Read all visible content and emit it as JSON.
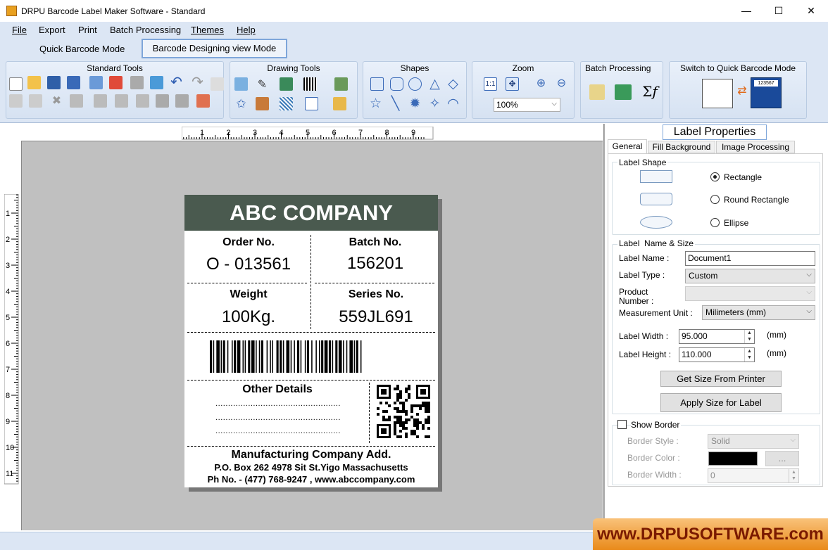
{
  "window": {
    "title": "DRPU Barcode Label Maker Software - Standard",
    "minimize": "—",
    "maximize": "☐",
    "close": "✕"
  },
  "menu": [
    "File",
    "Export",
    "Print",
    "Batch Processing",
    "Themes",
    "Help"
  ],
  "modes": {
    "quick": "Quick Barcode Mode",
    "designing": "Barcode Designing view Mode"
  },
  "ribbon": {
    "standard": "Standard Tools",
    "drawing": "Drawing Tools",
    "shapes": "Shapes",
    "zoom": "Zoom",
    "zoom_value": "100%",
    "batch": "Batch Processing",
    "switch": "Switch to Quick Barcode Mode",
    "switch_preview": "123567"
  },
  "ruler": {
    "top": [
      "1",
      "2",
      "3",
      "4",
      "5",
      "6",
      "7",
      "8",
      "9",
      "1"
    ],
    "left": [
      "1",
      "2",
      "3",
      "4",
      "5",
      "6",
      "7",
      "8",
      "9",
      "10",
      "11"
    ]
  },
  "label": {
    "company": "ABC COMPANY",
    "order_title": "Order No.",
    "order_value": "O - 013561",
    "batch_title": "Batch No.",
    "batch_value": "156201",
    "weight_title": "Weight",
    "weight_value": "100Kg.",
    "series_title": "Series No.",
    "series_value": "559JL691",
    "other_title": "Other Details",
    "dots": [
      "..................................................",
      "..................................................",
      ".................................................."
    ],
    "mfg_title": "Manufacturing Company Add.",
    "address": "P.O. Box 262 4978 Sit St.Yigo Massachusetts",
    "phone": "Ph No. - (477) 768-9247 , www.abccompany.com"
  },
  "properties": {
    "title": "Label Properties",
    "tabs": [
      "General",
      "Fill Background",
      "Image Processing"
    ],
    "shape_group": "Label Shape",
    "shapes": [
      "Rectangle",
      "Round Rectangle",
      "Ellipse"
    ],
    "selected_shape": "Rectangle",
    "name_group": "Label  Name & Size",
    "label_name_lbl": "Label Name :",
    "label_name": "Document1",
    "label_type_lbl": "Label Type :",
    "label_type": "Custom",
    "product_lbl1": "Product",
    "product_lbl2": "Number :",
    "unit_lbl": "Measurement Unit :",
    "unit": "Milimeters (mm)",
    "width_lbl": "Label Width :",
    "width": "95.000",
    "width_unit": "(mm)",
    "height_lbl": "Label Height :",
    "height": "110.000",
    "height_unit": "(mm)",
    "get_size": "Get Size From Printer",
    "apply_size": "Apply Size for Label",
    "show_border": "Show Border",
    "border_style_lbl": "Border Style :",
    "border_style": "Solid",
    "border_color_lbl": "Border Color :",
    "border_color_btn": "...",
    "border_color": "#000000",
    "border_width_lbl": "Border Width :",
    "border_width": "0"
  },
  "promo": "www.DRPUSOFTWARE.com"
}
